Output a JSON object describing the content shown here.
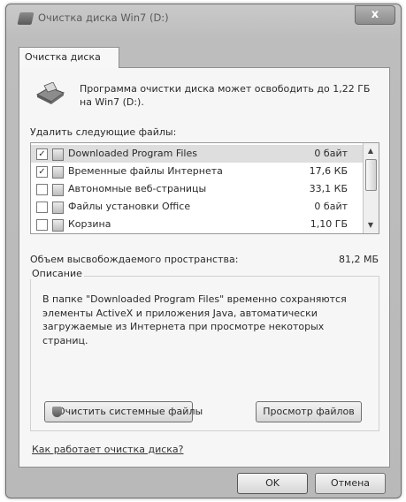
{
  "window": {
    "title": "Очистка диска Win7 (D:)",
    "close_label": "x"
  },
  "tab": {
    "label": "Очистка диска"
  },
  "intro": {
    "text": "Программа очистки диска может освободить до 1,22 ГБ на Win7 (D:)."
  },
  "files": {
    "label": "Удалить следующие файлы:",
    "items": [
      {
        "name": "Downloaded Program Files",
        "size": "0 байт",
        "checked": true,
        "selected": true
      },
      {
        "name": "Временные файлы Интернета",
        "size": "17,6 КБ",
        "checked": true,
        "selected": false
      },
      {
        "name": "Автономные веб-страницы",
        "size": "33,1 КБ",
        "checked": false,
        "selected": false
      },
      {
        "name": "Файлы установки Office",
        "size": "0 байт",
        "checked": false,
        "selected": false
      },
      {
        "name": "Корзина",
        "size": "1,10 ГБ",
        "checked": false,
        "selected": false
      }
    ],
    "check_glyph": "✓"
  },
  "space": {
    "label": "Объем высвобождаемого пространства:",
    "value": "81,2 МБ"
  },
  "description": {
    "title": "Описание",
    "text": "В папке \"Downloaded Program Files\" временно сохраняются элементы ActiveX и приложения Java, автоматически загружаемые из Интернета при просмотре некоторых страниц."
  },
  "buttons": {
    "clean_system": "Очистить системные файлы",
    "view_files": "Просмотр файлов",
    "ok": "OK",
    "cancel": "Отмена"
  },
  "help_link": "Как работает очистка диска?",
  "colors": {
    "window_frame": "#bdbdbd",
    "panel": "#f6f6f6",
    "selected_row": "#dedede"
  }
}
